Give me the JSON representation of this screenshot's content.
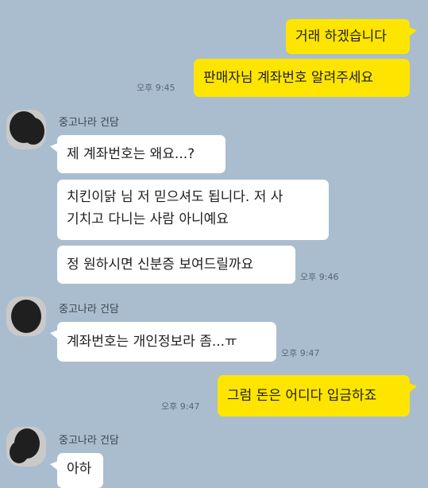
{
  "messages": {
    "m1": {
      "text": "거래 하겠습니다"
    },
    "m2": {
      "text": "판매자님 계좌번호 알려주세요",
      "time": "오후 9:45"
    },
    "m3": {
      "sender": "중고나라 건담",
      "text": "제 계좌번호는 왜요...?"
    },
    "m4": {
      "line1": "치킨이닭 님 저 믿으셔도 됩니다. 저 사",
      "line2": "기치고 다니는 사람 아니예요"
    },
    "m5": {
      "text": "정 원하시면 신분증 보여드릴까요",
      "time": "오후 9:46"
    },
    "m6": {
      "sender": "중고나라 건담",
      "text": "계좌번호는 개인정보라 좀...ㅠ",
      "time": "오후 9:47"
    },
    "m7": {
      "text": "그럼 돈은 어디다 입금하죠",
      "time": "오후 9:47"
    },
    "m8": {
      "sender": "중고나라 건담",
      "text": "아하"
    }
  },
  "colors": {
    "background": "#a9bdce",
    "outgoing_bubble": "#fee500",
    "incoming_bubble": "#ffffff"
  }
}
